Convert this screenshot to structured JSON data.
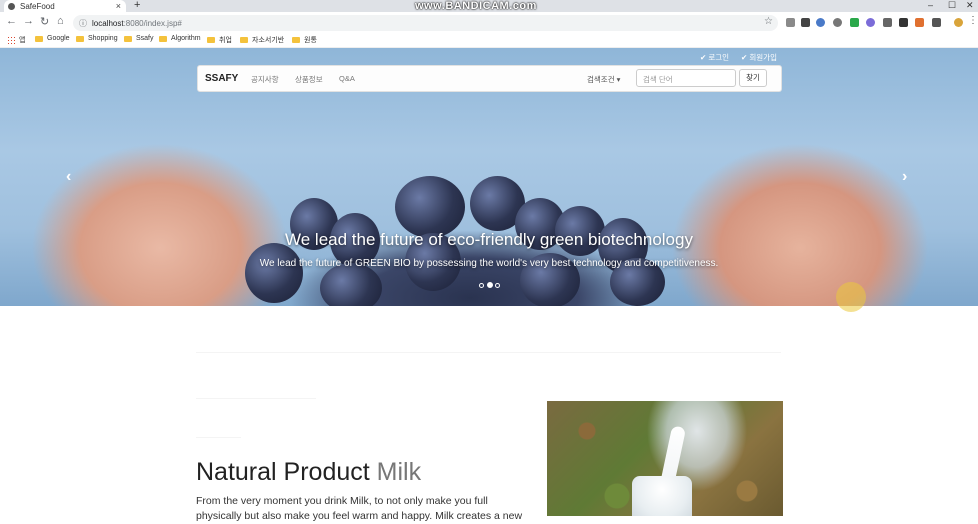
{
  "browser": {
    "tab_title": "SafeFood",
    "tab_close": "×",
    "new_tab": "+",
    "watermark": "www.BANDICAM.com",
    "url_host": "localhost",
    "url_path": ":8080/index.jsp#",
    "window_controls": [
      "–",
      "☐",
      "✕"
    ],
    "nav_icons": [
      "back-icon",
      "forward-icon",
      "reload-icon",
      "home-icon"
    ],
    "bookmarks": [
      "앱",
      "Google",
      "Shopping",
      "Ssafy",
      "Algorithm",
      "취업",
      "자소서기반",
      "원통"
    ]
  },
  "top_links": {
    "login": "✔ 로그인",
    "signup": "✔ 회원가입"
  },
  "navbar": {
    "brand": "SSAFY",
    "links": [
      "공지사항",
      "상품정보",
      "Q&A"
    ],
    "dropdown_label": "검색조건 ▾",
    "search_placeholder": "검색 단어",
    "search_button": "찾기"
  },
  "carousel": {
    "title": "We lead the future of eco-friendly green biotechnology",
    "subtitle": "We lead the future of GREEN BIO by possessing the world's very best technology and competitiveness.",
    "prev": "‹",
    "next": "›",
    "slides_total": 3,
    "active_slide": 2
  },
  "feature": {
    "title_main": "Natural Product ",
    "title_accent": "Milk",
    "body": "From the very moment you drink Milk, to not only make you full physically but also make you feel warm and happy. Milk creates a new"
  }
}
